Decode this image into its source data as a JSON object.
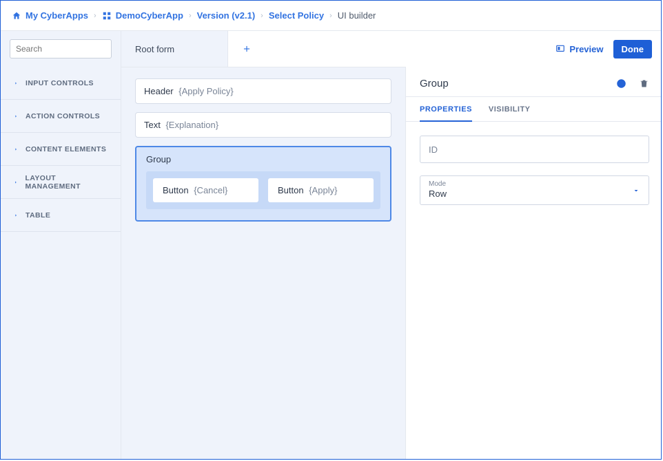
{
  "breadcrumb": [
    {
      "label": "My CyberApps",
      "icon": "home"
    },
    {
      "label": "DemoCyberApp",
      "icon": "grid"
    },
    {
      "label": "Version (v2.1)"
    },
    {
      "label": "Select Policy"
    },
    {
      "label": "UI builder",
      "last": true
    }
  ],
  "sidebar": {
    "search_placeholder": "Search",
    "groups": [
      {
        "label": "INPUT CONTROLS"
      },
      {
        "label": "ACTION CONTROLS"
      },
      {
        "label": "CONTENT ELEMENTS"
      },
      {
        "label": "LAYOUT MANAGEMENT"
      },
      {
        "label": "TABLE"
      }
    ]
  },
  "canvas": {
    "root_tab": "Root form",
    "preview_label": "Preview",
    "done_label": "Done",
    "blocks": {
      "header": {
        "type": "Header",
        "value": "{Apply Policy}"
      },
      "text": {
        "type": "Text",
        "value": "{Explanation}"
      },
      "group": {
        "type": "Group",
        "buttons": [
          {
            "type": "Button",
            "value": "{Cancel}"
          },
          {
            "type": "Button",
            "value": "{Apply}"
          }
        ]
      }
    }
  },
  "props": {
    "title": "Group",
    "tabs": {
      "properties": "PROPERTIES",
      "visibility": "VISIBILITY"
    },
    "id_placeholder": "ID",
    "mode_label": "Mode",
    "mode_value": "Row"
  }
}
